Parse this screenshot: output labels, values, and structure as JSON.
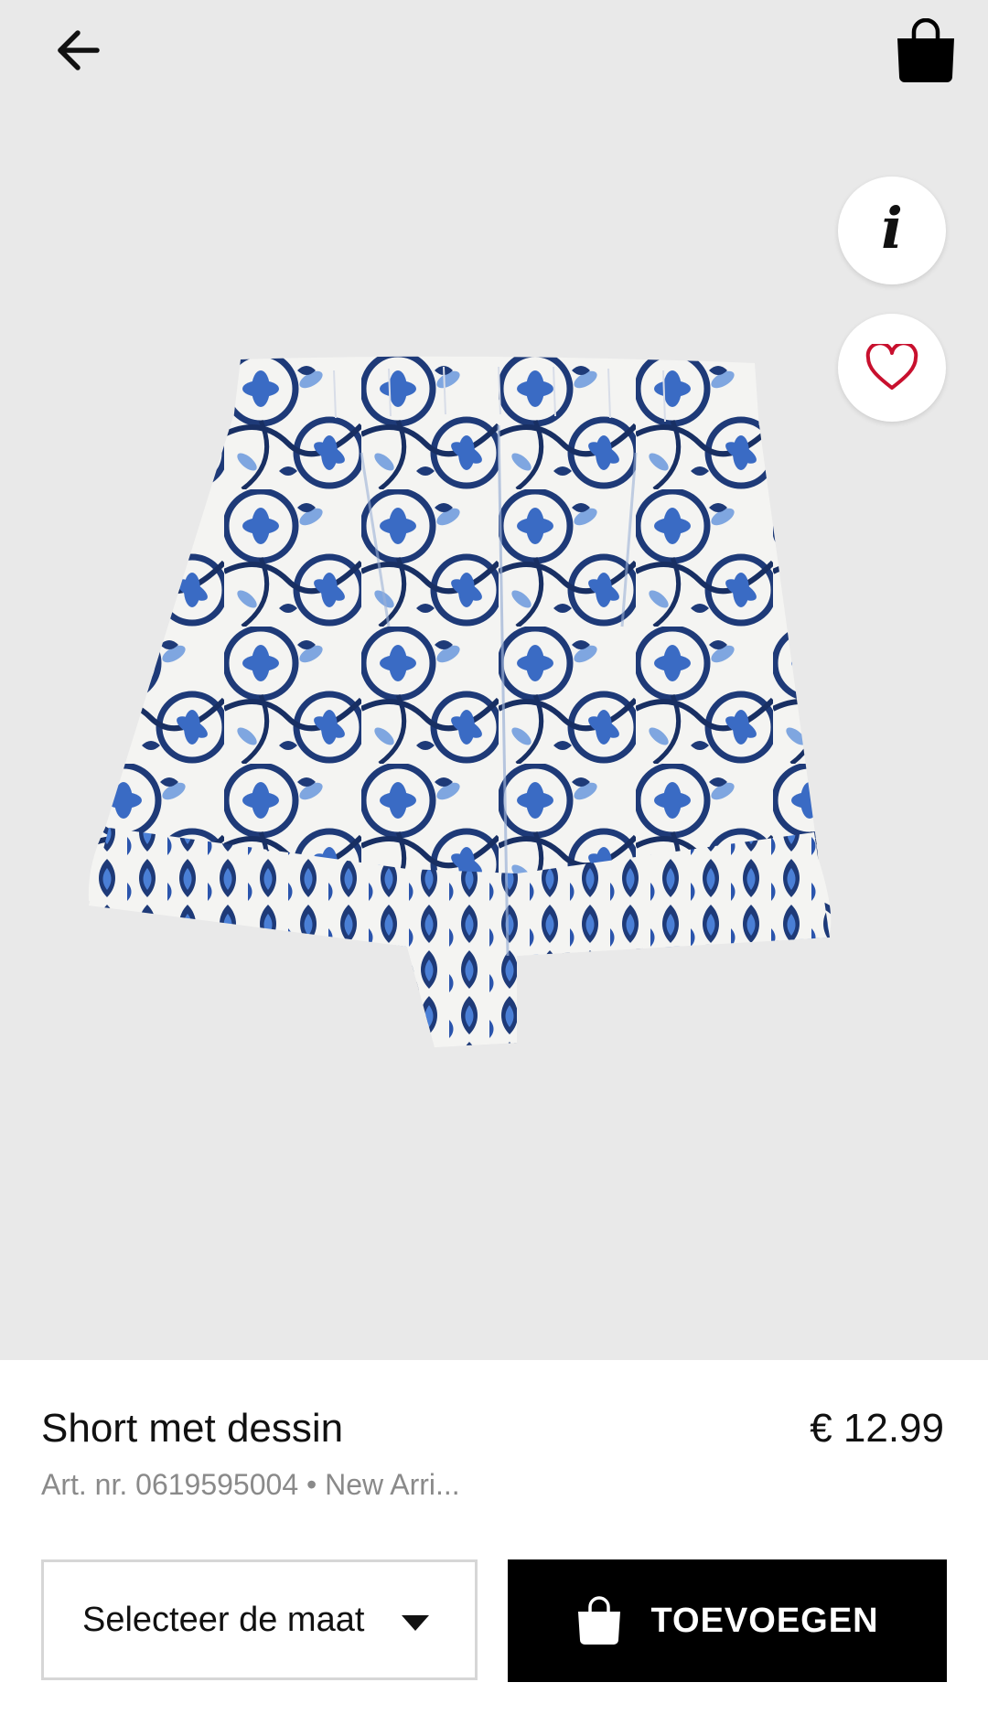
{
  "header": {
    "back_icon": "arrow-left-icon",
    "bag_icon": "shopping-bag-icon"
  },
  "actions": {
    "info_icon": "info-icon",
    "info_glyph": "i",
    "favorite_icon": "heart-outline-icon"
  },
  "product": {
    "image_description_icon": "product-photo",
    "title": "Short met dessin",
    "price": "€ 12.99",
    "meta": "Art. nr. 0619595004 • New Arri..."
  },
  "size_select": {
    "label": "Selecteer de maat",
    "caret_icon": "caret-down-icon"
  },
  "add_button": {
    "label": "TOEVOEGEN",
    "icon": "shopping-bag-icon"
  },
  "colors": {
    "image_background": "#e9e9e9",
    "accent_heart": "#c8102e",
    "button_background": "#000000",
    "meta_text": "#8a8a8a"
  }
}
